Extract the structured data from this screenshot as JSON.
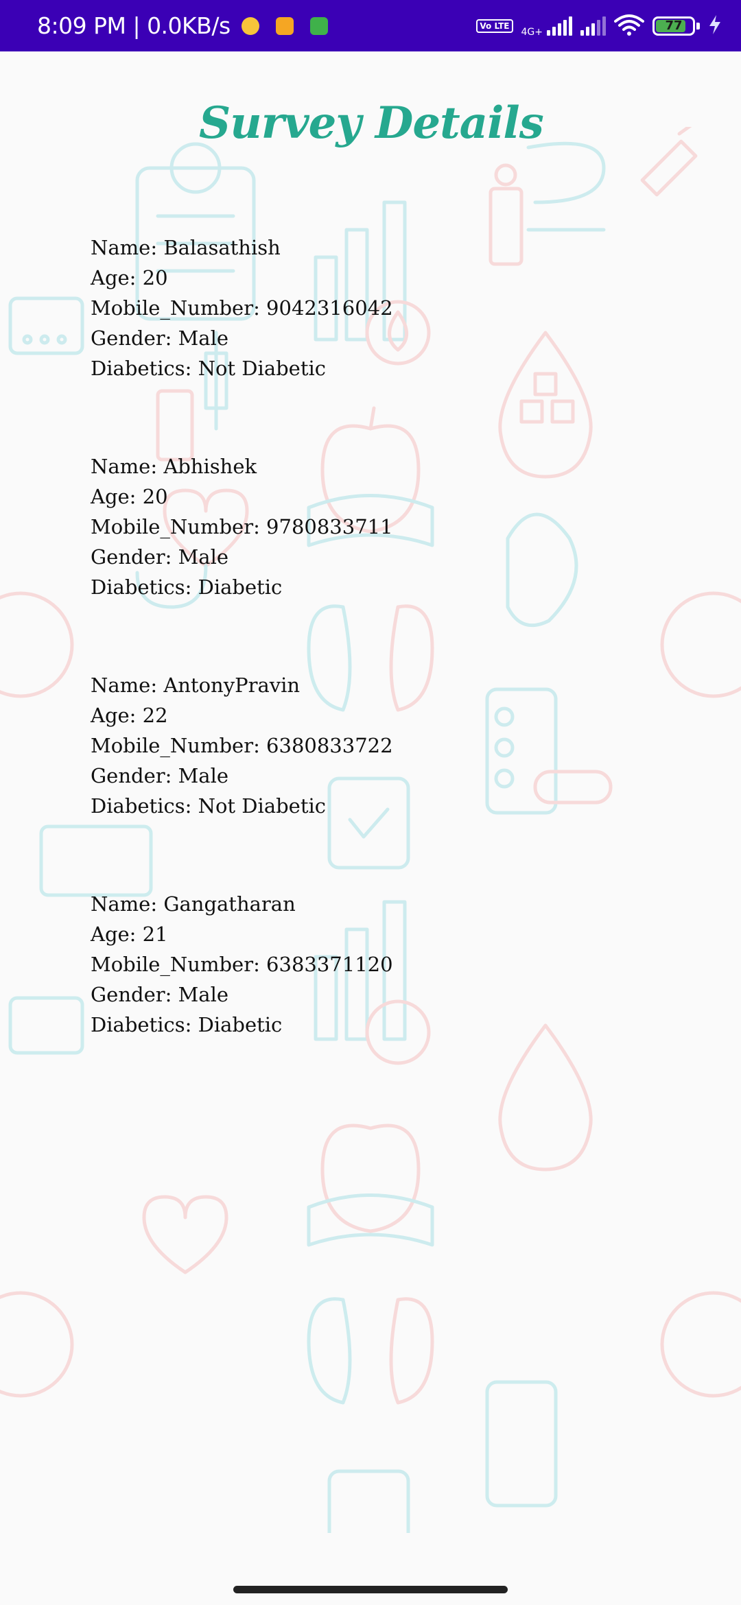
{
  "status_bar": {
    "time_and_speed": "8:09 PM | 0.0KB/s",
    "network_label": "4G+",
    "volte_label": "Vo LTE",
    "battery_level": "77",
    "colors": {
      "background": "#3b00b5",
      "battery_fill": "#4caf50"
    },
    "icons": [
      "notification-yellow-icon",
      "notification-orange-icon",
      "notification-green-icon",
      "volte-icon",
      "signal-icon",
      "signal-icon",
      "wifi-icon",
      "battery-icon",
      "charging-icon"
    ]
  },
  "page": {
    "title": "Survey Details",
    "title_color": "#26a88f"
  },
  "records": [
    {
      "name": "Name: Balasathish",
      "age": "Age: 20",
      "mobile": "Mobile_Number: 9042316042",
      "gender": "Gender: Male",
      "diabetics": "Diabetics: Not Diabetic"
    },
    {
      "name": "Name: Abhishek",
      "age": "Age: 20",
      "mobile": "Mobile_Number: 9780833711",
      "gender": "Gender: Male",
      "diabetics": "Diabetics: Diabetic"
    },
    {
      "name": "Name: AntonyPravin",
      "age": "Age: 22",
      "mobile": "Mobile_Number: 6380833722",
      "gender": "Gender: Male",
      "diabetics": "Diabetics: Not Diabetic"
    },
    {
      "name": "Name: Gangatharan",
      "age": "Age: 21",
      "mobile": "Mobile_Number: 6383371120",
      "gender": "Gender: Male",
      "diabetics": "Diabetics: Diabetic"
    }
  ],
  "background": {
    "watermark_icons": [
      "clipboard-icon",
      "bar-chart-icon",
      "blood-drop-icon",
      "syringe-icon",
      "apple-icon",
      "kidney-icon",
      "heart-icon",
      "pills-icon",
      "glucometer-icon",
      "stethoscope-icon"
    ]
  }
}
